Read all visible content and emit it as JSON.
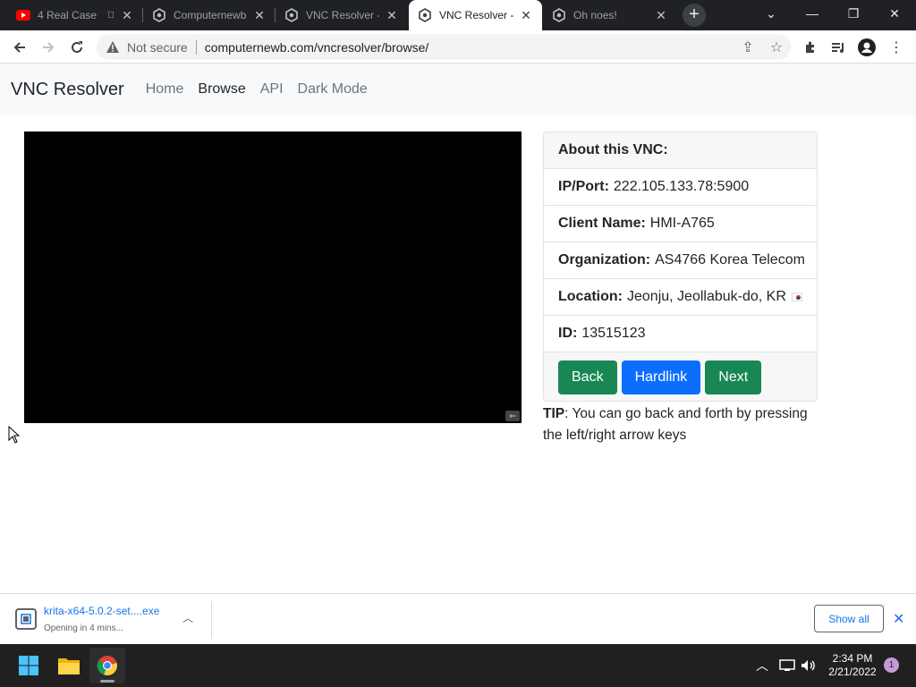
{
  "browser": {
    "tabs": [
      {
        "title": "4 Real Case",
        "favicon": "youtube-icon",
        "active": false
      },
      {
        "title": "Computernewb",
        "favicon": "vnc-resolver-icon",
        "active": false
      },
      {
        "title": "VNC Resolver -",
        "favicon": "vnc-resolver-icon",
        "active": false
      },
      {
        "title": "VNC Resolver -",
        "favicon": "vnc-resolver-icon",
        "active": true
      },
      {
        "title": "Oh noes!",
        "favicon": "vnc-resolver-icon",
        "active": false
      }
    ],
    "security_label": "Not secure",
    "url": "computernewb.com/vncresolver/browse/"
  },
  "site": {
    "brand": "VNC Resolver",
    "nav": [
      "Home",
      "Browse",
      "API",
      "Dark Mode"
    ],
    "active_nav": "Browse"
  },
  "vnc": {
    "card_title": "About this VNC:",
    "fields": [
      {
        "label": "IP/Port:",
        "value": "222.105.133.78:5900"
      },
      {
        "label": "Client Name:",
        "value": "HMI-A765"
      },
      {
        "label": "Organization:",
        "value": "AS4766 Korea Telecom"
      },
      {
        "label": "Location:",
        "value": "Jeonju, Jeollabuk-do, KR",
        "flag": "south-korea-flag-icon"
      },
      {
        "label": "ID:",
        "value": "13515123"
      }
    ],
    "buttons": {
      "back": "Back",
      "hardlink": "Hardlink",
      "next": "Next"
    },
    "tip_label": "TIP",
    "tip_text": ": You can go back and forth by pressing the left/right arrow keys"
  },
  "download": {
    "filename": "krita-x64-5.0.2-set....exe",
    "status": "Opening in 4 mins...",
    "show_all": "Show all"
  },
  "taskbar": {
    "time": "2:34 PM",
    "date": "2/21/2022",
    "notification_count": "1"
  },
  "colors": {
    "success": "#198754",
    "primary": "#0d6efd",
    "chrome_dark": "#202124"
  }
}
